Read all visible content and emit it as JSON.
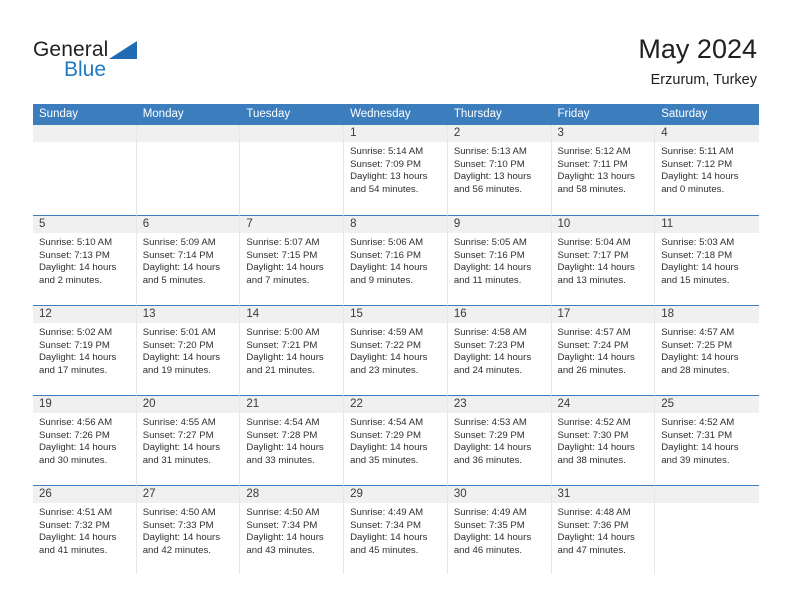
{
  "brand": {
    "name_top": "General",
    "name_bottom": "Blue",
    "color_top": "#231f20",
    "color_bottom": "#1f7ac4",
    "triangle_color": "#1f6cb5"
  },
  "header": {
    "title": "May 2024",
    "subtitle": "Erzurum, Turkey",
    "header_bg": "#3c7ebd",
    "header_text_color": "#ffffff"
  },
  "calendar": {
    "day_names": [
      "Sunday",
      "Monday",
      "Tuesday",
      "Wednesday",
      "Thursday",
      "Friday",
      "Saturday"
    ],
    "weeks": [
      [
        {
          "day": "",
          "sunrise": "",
          "sunset": "",
          "daylight_line1": "",
          "daylight_line2": ""
        },
        {
          "day": "",
          "sunrise": "",
          "sunset": "",
          "daylight_line1": "",
          "daylight_line2": ""
        },
        {
          "day": "",
          "sunrise": "",
          "sunset": "",
          "daylight_line1": "",
          "daylight_line2": ""
        },
        {
          "day": "1",
          "sunrise": "Sunrise: 5:14 AM",
          "sunset": "Sunset: 7:09 PM",
          "daylight_line1": "Daylight: 13 hours",
          "daylight_line2": "and 54 minutes."
        },
        {
          "day": "2",
          "sunrise": "Sunrise: 5:13 AM",
          "sunset": "Sunset: 7:10 PM",
          "daylight_line1": "Daylight: 13 hours",
          "daylight_line2": "and 56 minutes."
        },
        {
          "day": "3",
          "sunrise": "Sunrise: 5:12 AM",
          "sunset": "Sunset: 7:11 PM",
          "daylight_line1": "Daylight: 13 hours",
          "daylight_line2": "and 58 minutes."
        },
        {
          "day": "4",
          "sunrise": "Sunrise: 5:11 AM",
          "sunset": "Sunset: 7:12 PM",
          "daylight_line1": "Daylight: 14 hours",
          "daylight_line2": "and 0 minutes."
        }
      ],
      [
        {
          "day": "5",
          "sunrise": "Sunrise: 5:10 AM",
          "sunset": "Sunset: 7:13 PM",
          "daylight_line1": "Daylight: 14 hours",
          "daylight_line2": "and 2 minutes."
        },
        {
          "day": "6",
          "sunrise": "Sunrise: 5:09 AM",
          "sunset": "Sunset: 7:14 PM",
          "daylight_line1": "Daylight: 14 hours",
          "daylight_line2": "and 5 minutes."
        },
        {
          "day": "7",
          "sunrise": "Sunrise: 5:07 AM",
          "sunset": "Sunset: 7:15 PM",
          "daylight_line1": "Daylight: 14 hours",
          "daylight_line2": "and 7 minutes."
        },
        {
          "day": "8",
          "sunrise": "Sunrise: 5:06 AM",
          "sunset": "Sunset: 7:16 PM",
          "daylight_line1": "Daylight: 14 hours",
          "daylight_line2": "and 9 minutes."
        },
        {
          "day": "9",
          "sunrise": "Sunrise: 5:05 AM",
          "sunset": "Sunset: 7:16 PM",
          "daylight_line1": "Daylight: 14 hours",
          "daylight_line2": "and 11 minutes."
        },
        {
          "day": "10",
          "sunrise": "Sunrise: 5:04 AM",
          "sunset": "Sunset: 7:17 PM",
          "daylight_line1": "Daylight: 14 hours",
          "daylight_line2": "and 13 minutes."
        },
        {
          "day": "11",
          "sunrise": "Sunrise: 5:03 AM",
          "sunset": "Sunset: 7:18 PM",
          "daylight_line1": "Daylight: 14 hours",
          "daylight_line2": "and 15 minutes."
        }
      ],
      [
        {
          "day": "12",
          "sunrise": "Sunrise: 5:02 AM",
          "sunset": "Sunset: 7:19 PM",
          "daylight_line1": "Daylight: 14 hours",
          "daylight_line2": "and 17 minutes."
        },
        {
          "day": "13",
          "sunrise": "Sunrise: 5:01 AM",
          "sunset": "Sunset: 7:20 PM",
          "daylight_line1": "Daylight: 14 hours",
          "daylight_line2": "and 19 minutes."
        },
        {
          "day": "14",
          "sunrise": "Sunrise: 5:00 AM",
          "sunset": "Sunset: 7:21 PM",
          "daylight_line1": "Daylight: 14 hours",
          "daylight_line2": "and 21 minutes."
        },
        {
          "day": "15",
          "sunrise": "Sunrise: 4:59 AM",
          "sunset": "Sunset: 7:22 PM",
          "daylight_line1": "Daylight: 14 hours",
          "daylight_line2": "and 23 minutes."
        },
        {
          "day": "16",
          "sunrise": "Sunrise: 4:58 AM",
          "sunset": "Sunset: 7:23 PM",
          "daylight_line1": "Daylight: 14 hours",
          "daylight_line2": "and 24 minutes."
        },
        {
          "day": "17",
          "sunrise": "Sunrise: 4:57 AM",
          "sunset": "Sunset: 7:24 PM",
          "daylight_line1": "Daylight: 14 hours",
          "daylight_line2": "and 26 minutes."
        },
        {
          "day": "18",
          "sunrise": "Sunrise: 4:57 AM",
          "sunset": "Sunset: 7:25 PM",
          "daylight_line1": "Daylight: 14 hours",
          "daylight_line2": "and 28 minutes."
        }
      ],
      [
        {
          "day": "19",
          "sunrise": "Sunrise: 4:56 AM",
          "sunset": "Sunset: 7:26 PM",
          "daylight_line1": "Daylight: 14 hours",
          "daylight_line2": "and 30 minutes."
        },
        {
          "day": "20",
          "sunrise": "Sunrise: 4:55 AM",
          "sunset": "Sunset: 7:27 PM",
          "daylight_line1": "Daylight: 14 hours",
          "daylight_line2": "and 31 minutes."
        },
        {
          "day": "21",
          "sunrise": "Sunrise: 4:54 AM",
          "sunset": "Sunset: 7:28 PM",
          "daylight_line1": "Daylight: 14 hours",
          "daylight_line2": "and 33 minutes."
        },
        {
          "day": "22",
          "sunrise": "Sunrise: 4:54 AM",
          "sunset": "Sunset: 7:29 PM",
          "daylight_line1": "Daylight: 14 hours",
          "daylight_line2": "and 35 minutes."
        },
        {
          "day": "23",
          "sunrise": "Sunrise: 4:53 AM",
          "sunset": "Sunset: 7:29 PM",
          "daylight_line1": "Daylight: 14 hours",
          "daylight_line2": "and 36 minutes."
        },
        {
          "day": "24",
          "sunrise": "Sunrise: 4:52 AM",
          "sunset": "Sunset: 7:30 PM",
          "daylight_line1": "Daylight: 14 hours",
          "daylight_line2": "and 38 minutes."
        },
        {
          "day": "25",
          "sunrise": "Sunrise: 4:52 AM",
          "sunset": "Sunset: 7:31 PM",
          "daylight_line1": "Daylight: 14 hours",
          "daylight_line2": "and 39 minutes."
        }
      ],
      [
        {
          "day": "26",
          "sunrise": "Sunrise: 4:51 AM",
          "sunset": "Sunset: 7:32 PM",
          "daylight_line1": "Daylight: 14 hours",
          "daylight_line2": "and 41 minutes."
        },
        {
          "day": "27",
          "sunrise": "Sunrise: 4:50 AM",
          "sunset": "Sunset: 7:33 PM",
          "daylight_line1": "Daylight: 14 hours",
          "daylight_line2": "and 42 minutes."
        },
        {
          "day": "28",
          "sunrise": "Sunrise: 4:50 AM",
          "sunset": "Sunset: 7:34 PM",
          "daylight_line1": "Daylight: 14 hours",
          "daylight_line2": "and 43 minutes."
        },
        {
          "day": "29",
          "sunrise": "Sunrise: 4:49 AM",
          "sunset": "Sunset: 7:34 PM",
          "daylight_line1": "Daylight: 14 hours",
          "daylight_line2": "and 45 minutes."
        },
        {
          "day": "30",
          "sunrise": "Sunrise: 4:49 AM",
          "sunset": "Sunset: 7:35 PM",
          "daylight_line1": "Daylight: 14 hours",
          "daylight_line2": "and 46 minutes."
        },
        {
          "day": "31",
          "sunrise": "Sunrise: 4:48 AM",
          "sunset": "Sunset: 7:36 PM",
          "daylight_line1": "Daylight: 14 hours",
          "daylight_line2": "and 47 minutes."
        },
        {
          "day": "",
          "sunrise": "",
          "sunset": "",
          "daylight_line1": "",
          "daylight_line2": ""
        }
      ]
    ]
  }
}
